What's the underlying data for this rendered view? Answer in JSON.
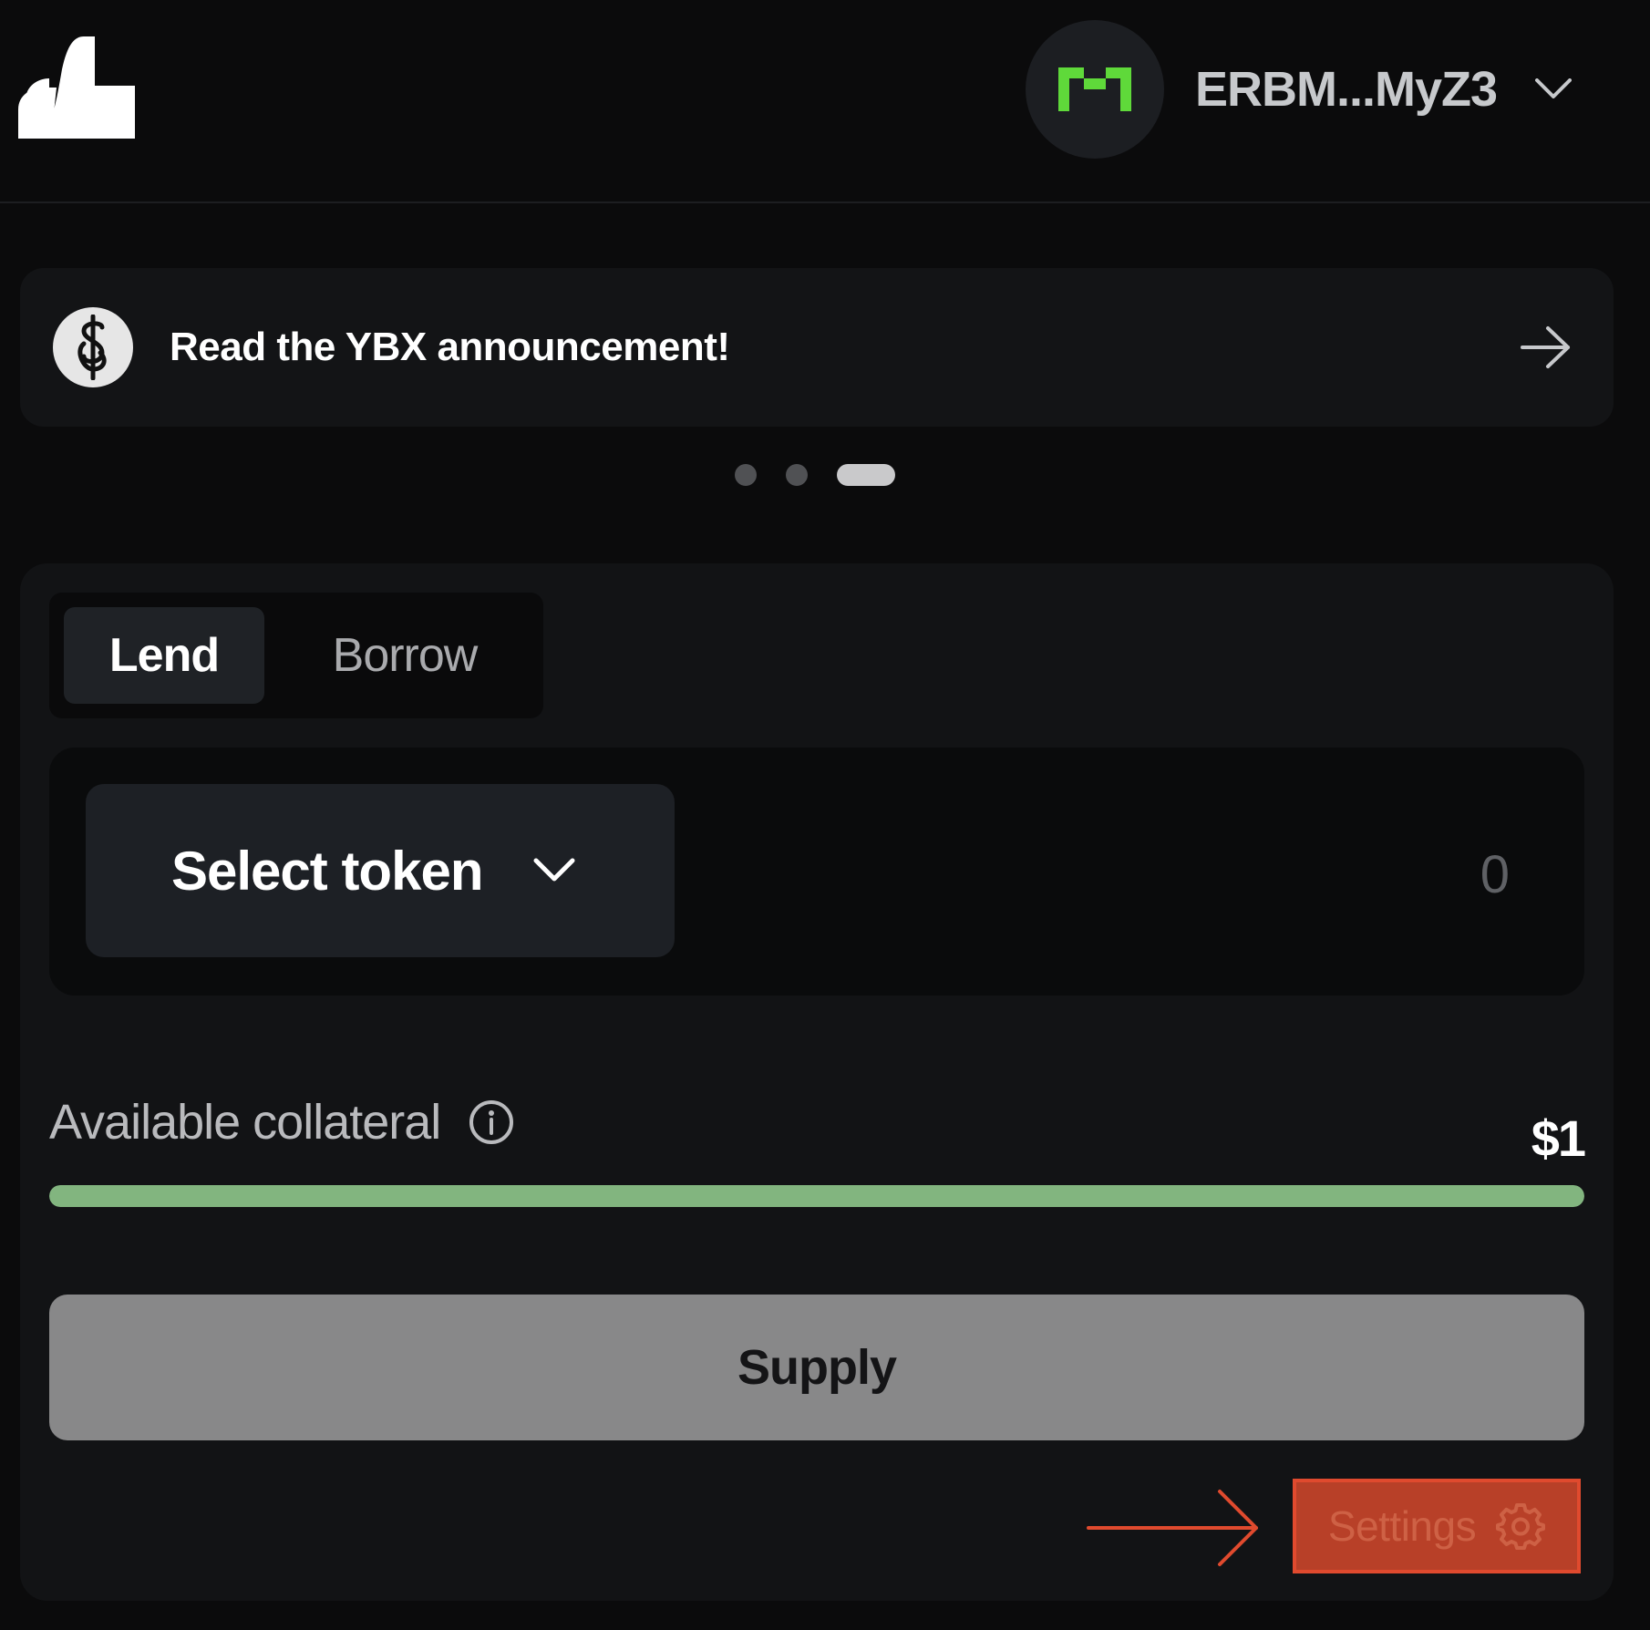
{
  "header": {
    "logo_icon": "brand-logo-icon",
    "wallet": {
      "avatar_icon": "pixel-m-avatar-icon",
      "avatar_color": "#5fd93a",
      "address": "ERBM...MyZ3",
      "chevron_icon": "chevron-down-icon"
    }
  },
  "banner": {
    "icon": "dollar-chain-icon",
    "text": "Read the YBX announcement!",
    "arrow_icon": "arrow-right-icon"
  },
  "carousel": {
    "total": 3,
    "active_index": 2
  },
  "tabs": {
    "items": [
      {
        "label": "Lend",
        "active": true
      },
      {
        "label": "Borrow",
        "active": false
      }
    ]
  },
  "token_input": {
    "select_label": "Select token",
    "chevron_icon": "chevron-down-icon",
    "amount_placeholder": "0",
    "amount_value": ""
  },
  "collateral": {
    "label": "Available collateral",
    "info_icon": "info-icon",
    "value": "$1",
    "fill_fraction": 1.0,
    "bar_color": "#82b57f"
  },
  "supply_button": {
    "label": "Supply"
  },
  "settings_button": {
    "label": "Settings",
    "icon": "gear-icon",
    "highlight_color": "#e04a2e"
  },
  "colors": {
    "background": "#0b0b0c",
    "card": "#121315",
    "accent_green": "#82b57f",
    "annotation_red": "#e04a2e"
  }
}
